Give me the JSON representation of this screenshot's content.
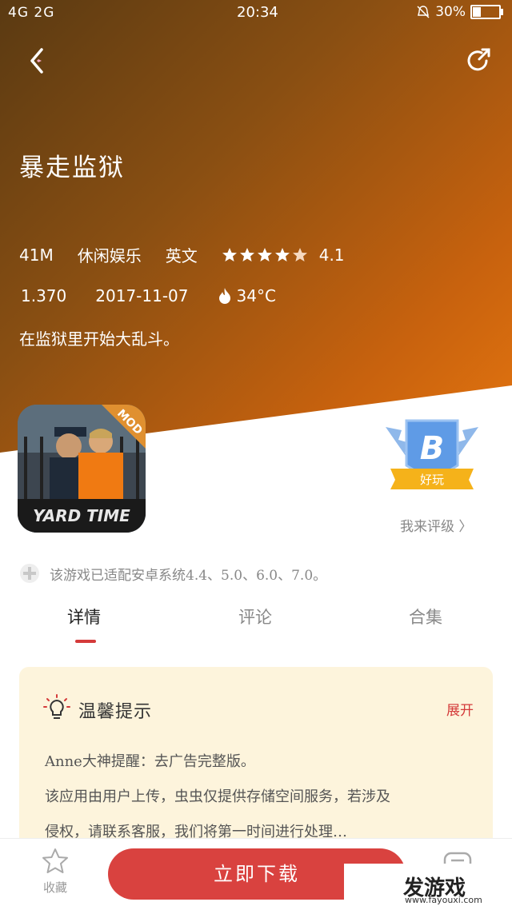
{
  "status": {
    "signal_left": "4G 2G",
    "time": "20:34",
    "battery": "30%"
  },
  "app": {
    "title": "暴走监狱",
    "size": "41M",
    "category": "休闲娱乐",
    "language": "英文",
    "rating": "4.1",
    "version": "1.370",
    "date": "2017-11-07",
    "heat": "34°C",
    "description": "在监狱里开始大乱斗。",
    "icon_badge": "MOD",
    "icon_caption": "YARD TIME"
  },
  "grade": {
    "letter": "B",
    "ribbon": "好玩",
    "link": "我来评级 〉"
  },
  "compat_text": "该游戏已适配安卓系统4.4、5.0、6.0、7.0。",
  "tabs": [
    {
      "label": "详情"
    },
    {
      "label": "评论"
    },
    {
      "label": "合集"
    }
  ],
  "tips": {
    "title": "温馨提示",
    "expand": "展开",
    "lines": [
      "Anne大神提醒：去广告完整版。",
      "该应用由用户上传，虫虫仅提供存储空间服务，若涉及",
      "侵权，请联系客服，我们将第一时间进行处理…"
    ]
  },
  "bottom": {
    "favorite": "收藏",
    "download": "立即下载"
  },
  "watermark": {
    "text": "发游戏",
    "url": "www.fayouxi.com"
  },
  "colors": {
    "accent": "#d9423f",
    "hero_start": "#5a3a12",
    "hero_end": "#f07d10",
    "tips_bg": "#fdf4dc"
  }
}
